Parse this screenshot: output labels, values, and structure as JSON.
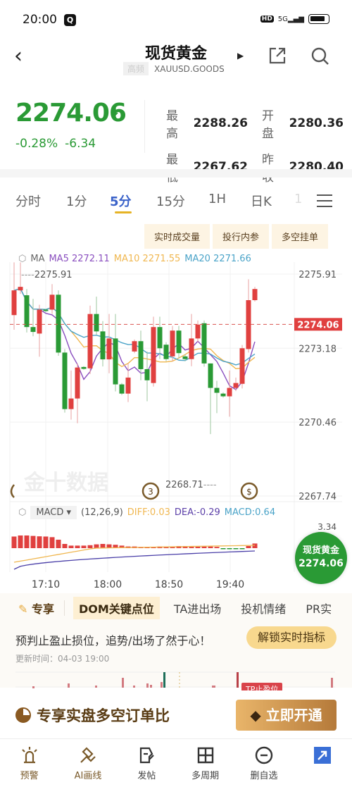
{
  "status_bar": {
    "time": "20:00",
    "network": "5G",
    "hd": "HD"
  },
  "header": {
    "title": "现货黄金",
    "tag": "高频",
    "symbol": "XAUUSD.GOODS"
  },
  "quote": {
    "price": "2274.06",
    "change_pct": "-0.28%",
    "change": "-6.34",
    "stats": [
      {
        "label": "最高",
        "value": "2288.26"
      },
      {
        "label": "开盘",
        "value": "2280.36"
      },
      {
        "label": "最低",
        "value": "2267.62"
      },
      {
        "label": "昨收",
        "value": "2280.40"
      }
    ]
  },
  "period_tabs": [
    "分时",
    "1分",
    "5分",
    "15分",
    "1H",
    "日K",
    "1"
  ],
  "active_period": "5分",
  "tool_pills": [
    "实时成交量",
    "投行内参",
    "多空挂单"
  ],
  "ma_legend": {
    "label": "MA",
    "ma5": "MA5 2272.11",
    "ma10": "MA10 2271.55",
    "ma20": "MA20 2271.66"
  },
  "macd_legend": {
    "select": "MACD",
    "params": "(12,26,9)",
    "diff": "DIFF:0.03",
    "dea": "DEA:-0.29",
    "macd": "MACD:0.64"
  },
  "colors": {
    "up": "#e0403f",
    "down": "#2a9a35",
    "ma5": "#8a4fbf",
    "ma10": "#f0b750",
    "ma20": "#4aa3c8",
    "accent": "#3a62c9"
  },
  "chart_data": {
    "type": "candlestick",
    "y_ticks": [
      "2275.91",
      "2273.18",
      "2270.46",
      "2267.74"
    ],
    "ylim": [
      2267.74,
      2275.91
    ],
    "x_ticks": [
      "17:10",
      "18:00",
      "18:50",
      "19:40"
    ],
    "last_price_label": "2274.06",
    "high_marker": "2275.91",
    "low_marker": "2268.71",
    "macd_top_label": "3.34",
    "watermark": "金十数据",
    "event_markers": [
      "3",
      "$"
    ],
    "candles": [
      {
        "o": 2274.4,
        "c": 2275.31,
        "h": 2276.34,
        "l": 2273.86
      },
      {
        "o": 2275.31,
        "c": 2275.44,
        "h": 2276.34,
        "l": 2275.18
      },
      {
        "o": 2275.13,
        "c": 2273.96,
        "h": 2275.36,
        "l": 2273.76
      },
      {
        "o": 2273.96,
        "c": 2273.78,
        "h": 2275.0,
        "l": 2273.62
      },
      {
        "o": 2273.72,
        "c": 2274.6,
        "h": 2274.78,
        "l": 2272.87
      },
      {
        "o": 2274.6,
        "c": 2274.55,
        "h": 2274.62,
        "l": 2274.5
      },
      {
        "o": 2274.6,
        "c": 2275.15,
        "h": 2275.54,
        "l": 2274.44
      },
      {
        "o": 2275.15,
        "c": 2273.02,
        "h": 2275.31,
        "l": 2272.9
      },
      {
        "o": 2273.02,
        "c": 2270.94,
        "h": 2273.15,
        "l": 2270.81
      },
      {
        "o": 2270.94,
        "c": 2271.33,
        "h": 2272.36,
        "l": 2270.55
      },
      {
        "o": 2271.33,
        "c": 2272.47,
        "h": 2272.62,
        "l": 2270.42
      },
      {
        "o": 2272.49,
        "c": 2272.42,
        "h": 2272.52,
        "l": 2272.39
      },
      {
        "o": 2272.44,
        "c": 2274.44,
        "h": 2274.75,
        "l": 2272.23
      },
      {
        "o": 2274.44,
        "c": 2273.8,
        "h": 2275.08,
        "l": 2273.67
      },
      {
        "o": 2273.8,
        "c": 2272.77,
        "h": 2274.18,
        "l": 2272.51
      },
      {
        "o": 2272.77,
        "c": 2273.54,
        "h": 2274.44,
        "l": 2272.26
      },
      {
        "o": 2273.54,
        "c": 2271.85,
        "h": 2274.44,
        "l": 2271.59
      },
      {
        "o": 2271.85,
        "c": 2271.51,
        "h": 2271.9,
        "l": 2271.46
      },
      {
        "o": 2271.51,
        "c": 2272.1,
        "h": 2272.62,
        "l": 2271.2
      },
      {
        "o": 2273.06,
        "c": 2273.44,
        "h": 2273.5,
        "l": 2273.0
      },
      {
        "o": 2273.44,
        "c": 2272.41,
        "h": 2273.83,
        "l": 2272.0
      },
      {
        "o": 2272.41,
        "c": 2272.0,
        "h": 2273.06,
        "l": 2271.23
      },
      {
        "o": 2271.9,
        "c": 2273.96,
        "h": 2274.34,
        "l": 2271.77
      },
      {
        "o": 2273.96,
        "c": 2273.18,
        "h": 2274.34,
        "l": 2272.78
      },
      {
        "o": 2273.31,
        "c": 2272.78,
        "h": 2273.4,
        "l": 2272.7
      },
      {
        "o": 2272.88,
        "c": 2273.83,
        "h": 2274.0,
        "l": 2272.7
      },
      {
        "o": 2273.83,
        "c": 2273.0,
        "h": 2274.0,
        "l": 2272.8
      },
      {
        "o": 2272.88,
        "c": 2272.78,
        "h": 2272.95,
        "l": 2272.7
      },
      {
        "o": 2272.78,
        "c": 2273.54,
        "h": 2274.44,
        "l": 2272.52
      },
      {
        "o": 2273.54,
        "c": 2274.05,
        "h": 2274.2,
        "l": 2273.4
      },
      {
        "o": 2274.1,
        "c": 2272.62,
        "h": 2274.2,
        "l": 2272.5
      },
      {
        "o": 2272.62,
        "c": 2271.72,
        "h": 2272.62,
        "l": 2270.02
      },
      {
        "o": 2271.72,
        "c": 2271.54,
        "h": 2271.98,
        "l": 2270.79
      },
      {
        "o": 2271.51,
        "c": 2271.41,
        "h": 2271.56,
        "l": 2271.36
      },
      {
        "o": 2271.41,
        "c": 2271.72,
        "h": 2272.36,
        "l": 2270.66
      },
      {
        "o": 2271.72,
        "c": 2271.9,
        "h": 2272.1,
        "l": 2271.6
      },
      {
        "o": 2271.87,
        "c": 2273.18,
        "h": 2273.3,
        "l": 2271.7
      },
      {
        "o": 2273.15,
        "c": 2274.95,
        "h": 2275.72,
        "l": 2273.02
      },
      {
        "o": 2274.95,
        "c": 2275.36,
        "h": 2275.44,
        "l": 2274.9
      }
    ],
    "macd_hist": [
      0.55,
      0.6,
      0.6,
      0.58,
      0.56,
      0.55,
      0.52,
      0.4,
      0.2,
      0.12,
      0.12,
      0.12,
      0.14,
      0.18,
      0.2,
      0.18,
      0.16,
      0.12,
      0.08,
      0.08,
      0.06,
      0.06,
      0.06,
      0.08,
      0.08,
      0.08,
      0.1,
      0.1,
      0.08,
      0.08,
      0.1,
      0.08,
      0.06,
      -0.04,
      -0.04,
      -0.04,
      -0.04,
      0.1,
      0.22
    ]
  },
  "exclusive": {
    "label": "专享",
    "tabs": [
      "DOM关键点位",
      "TA进出场",
      "投机情绪",
      "PR实"
    ],
    "active": "DOM关键点位",
    "description": "预判止盈止损位，追势/出场了然于心！",
    "unlock_button": "解锁实时指标",
    "updated": "更新时间：04-03 19:00",
    "tp_label": "TP止盈位"
  },
  "promo": {
    "text": "专享实盘多空订单比",
    "button": "立即开通"
  },
  "bottom_nav": [
    {
      "label": "预警",
      "icon": "alarm-icon"
    },
    {
      "label": "AI画线",
      "icon": "draw-line-icon"
    },
    {
      "label": "发帖",
      "icon": "post-icon"
    },
    {
      "label": "多周期",
      "icon": "grid-icon"
    },
    {
      "label": "删自选",
      "icon": "remove-watchlist-icon"
    }
  ],
  "bubble": {
    "name": "现货黄金",
    "price": "2274.06"
  }
}
